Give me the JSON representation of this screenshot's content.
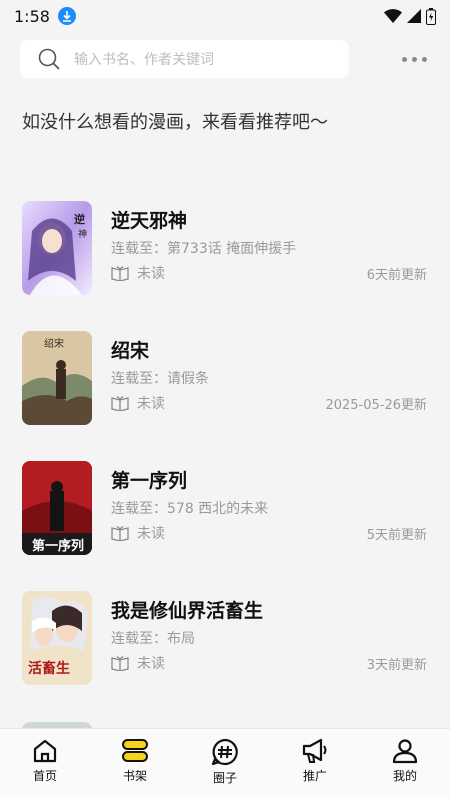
{
  "status_bar": {
    "time": "1:58"
  },
  "search": {
    "placeholder": "输入书名、作者关键词"
  },
  "promo_text": "如没什么想看的漫画，来看看推荐吧～",
  "books": [
    {
      "title": "逆天邪神",
      "latest": "连载至：第733话 掩面伸援手",
      "read_status": "未读",
      "updated": "6天前更新"
    },
    {
      "title": "绍宋",
      "latest": "连载至：请假条",
      "read_status": "未读",
      "updated": "2025-05-26更新"
    },
    {
      "title": "第一序列",
      "latest": "连载至：578 西北的未来",
      "read_status": "未读",
      "updated": "5天前更新"
    },
    {
      "title": "我是修仙界活畜生",
      "latest": "连载至：布局",
      "read_status": "未读",
      "updated": "3天前更新"
    }
  ],
  "nav": [
    {
      "label": "首页",
      "icon": "home-icon"
    },
    {
      "label": "书架",
      "icon": "bookshelf-icon"
    },
    {
      "label": "圈子",
      "icon": "hashtag-bubble-icon"
    },
    {
      "label": "推广",
      "icon": "megaphone-icon"
    },
    {
      "label": "我的",
      "icon": "profile-icon"
    }
  ],
  "colors": {
    "accent": "#f5d21c",
    "download_badge": "#1a8cff",
    "muted": "#9a9a9a"
  }
}
